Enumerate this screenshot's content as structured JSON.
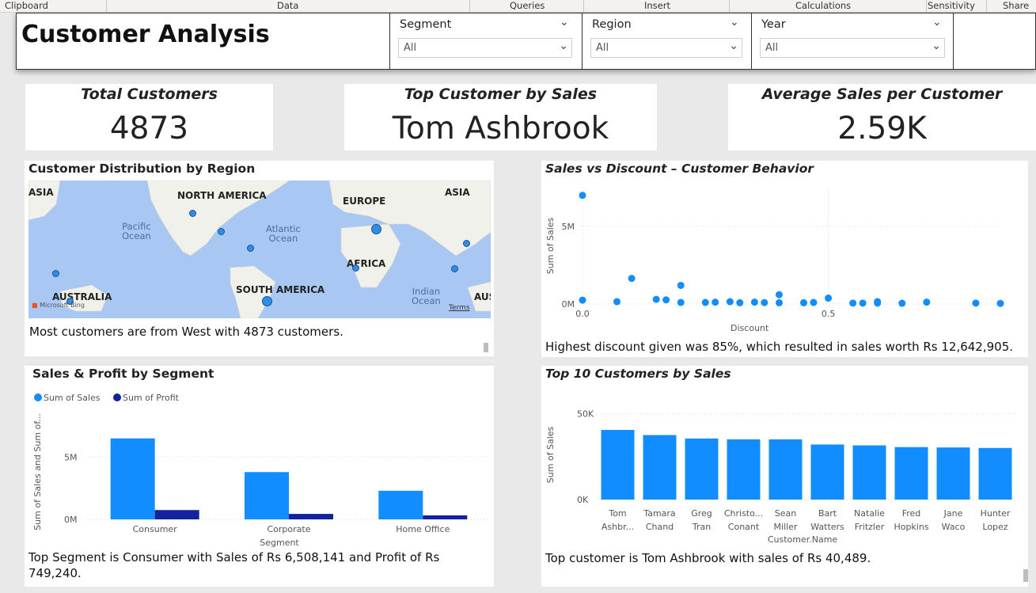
{
  "ribbon": {
    "clipboard": "Clipboard",
    "data": "Data",
    "queries": "Queries",
    "insert": "Insert",
    "calculations": "Calculations",
    "sensitivity": "Sensitivity",
    "share": "Share"
  },
  "header": {
    "title": "Customer Analysis",
    "slicers": [
      {
        "label": "Segment",
        "value": "All"
      },
      {
        "label": "Region",
        "value": "All"
      },
      {
        "label": "Year",
        "value": "All"
      }
    ]
  },
  "kpis": [
    {
      "label": "Total Customers",
      "value": "4873"
    },
    {
      "label": "Top Customer by Sales",
      "value": "Tom Ashbrook"
    },
    {
      "label": "Average Sales per Customer",
      "value": "2.59K"
    }
  ],
  "map_visual": {
    "title": "Customer Distribution by Region",
    "labels": {
      "asia_left": "ASIA",
      "north_america": "NORTH AMERICA",
      "europe": "EUROPE",
      "asia": "ASIA",
      "africa": "AFRICA",
      "south_america": "SOUTH AMERICA",
      "australia": "AUSTRALIA",
      "aus": "AUS"
    },
    "oceans": {
      "pacific": "Pacific\nOcean",
      "atlantic": "Atlantic\nOcean",
      "indian": "Indian\nOcean"
    },
    "attribution": "Microsoft Bing",
    "terms": "Terms",
    "narrative": "Most customers are from West with 4873 customers."
  },
  "scatter_visual": {
    "title": "Sales vs Discount – Customer Behavior",
    "narrative": "Highest discount given was 85%, which resulted in sales worth Rs 12,642,905."
  },
  "segment_visual": {
    "title": "Sales & Profit by Segment",
    "narrative": "Top Segment is Consumer with Sales of Rs 6,508,141 and Profit of Rs 749,240."
  },
  "top10_visual": {
    "title": "Top 10 Customers by Sales",
    "narrative": "Top customer is Tom Ashbrook with sales of Rs 40,489."
  },
  "colors": {
    "sales": "#118dff",
    "profit": "#12239e",
    "map_water": "#a8c8f3",
    "map_land": "#f1f1ec"
  },
  "chart_data": [
    {
      "id": "scatter",
      "type": "scatter",
      "title": "Sales vs Discount – Customer Behavior",
      "xlabel": "Discount",
      "ylabel": "Sum of Sales",
      "xlim": [
        0,
        0.85
      ],
      "ylim": [
        0,
        7500000
      ],
      "x_ticks": [
        "0.0",
        "0.5"
      ],
      "y_ticks": [
        "0M",
        "5M"
      ],
      "grid": true,
      "points": [
        {
          "x": 0.0,
          "y": 7000000
        },
        {
          "x": 0.0,
          "y": 250000
        },
        {
          "x": 0.07,
          "y": 150000
        },
        {
          "x": 0.1,
          "y": 1650000
        },
        {
          "x": 0.15,
          "y": 300000
        },
        {
          "x": 0.17,
          "y": 270000
        },
        {
          "x": 0.2,
          "y": 1200000
        },
        {
          "x": 0.2,
          "y": 100000
        },
        {
          "x": 0.25,
          "y": 100000
        },
        {
          "x": 0.27,
          "y": 120000
        },
        {
          "x": 0.3,
          "y": 150000
        },
        {
          "x": 0.32,
          "y": 80000
        },
        {
          "x": 0.35,
          "y": 120000
        },
        {
          "x": 0.37,
          "y": 90000
        },
        {
          "x": 0.4,
          "y": 600000
        },
        {
          "x": 0.4,
          "y": 80000
        },
        {
          "x": 0.45,
          "y": 80000
        },
        {
          "x": 0.47,
          "y": 100000
        },
        {
          "x": 0.5,
          "y": 380000
        },
        {
          "x": 0.55,
          "y": 60000
        },
        {
          "x": 0.57,
          "y": 60000
        },
        {
          "x": 0.6,
          "y": 150000
        },
        {
          "x": 0.6,
          "y": 60000
        },
        {
          "x": 0.65,
          "y": 50000
        },
        {
          "x": 0.7,
          "y": 120000
        },
        {
          "x": 0.8,
          "y": 60000
        },
        {
          "x": 0.85,
          "y": 40000
        }
      ]
    },
    {
      "id": "segment",
      "type": "bar",
      "title": "Sales & Profit by Segment",
      "xlabel": "Segment",
      "ylabel": "Sum of Sales and Sum of...",
      "categories": [
        "Consumer",
        "Corporate",
        "Home Office"
      ],
      "series": [
        {
          "name": "Sum of Sales",
          "color": "#118dff",
          "values": [
            6508141,
            3800000,
            2300000
          ]
        },
        {
          "name": "Sum of Profit",
          "color": "#12239e",
          "values": [
            749240,
            440000,
            320000
          ]
        }
      ],
      "y_ticks": [
        "0M",
        "5M"
      ],
      "ylim": [
        0,
        7000000
      ],
      "grid": true,
      "legend": "top-left"
    },
    {
      "id": "top10",
      "type": "bar",
      "title": "Top 10 Customers by Sales",
      "xlabel": "Customer.Name",
      "ylabel": "Sum of Sales",
      "categories": [
        "Tom Ashbr...",
        "Tamara Chand",
        "Greg Tran",
        "Christo... Conant",
        "Sean Miller",
        "Bart Watters",
        "Natalie Fritzler",
        "Fred Hopkins",
        "Jane Waco",
        "Hunter Lopez"
      ],
      "values": [
        40489,
        37500,
        35500,
        35000,
        35000,
        32000,
        31500,
        30500,
        30300,
        30000
      ],
      "y_ticks": [
        "0K",
        "50K"
      ],
      "ylim": [
        0,
        52000
      ],
      "grid": true
    }
  ]
}
